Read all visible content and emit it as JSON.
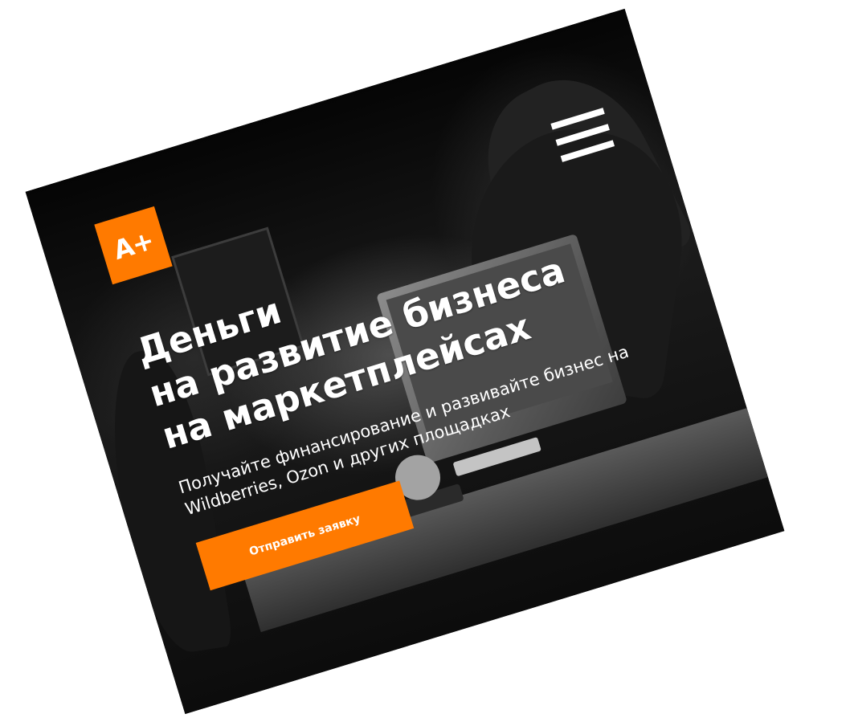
{
  "brand": {
    "logo_text": "A+",
    "accent_color": "#ff7a00"
  },
  "header": {
    "menu_icon": "hamburger-menu-icon"
  },
  "hero": {
    "headline_lines": [
      "Деньги",
      "на развитие бизнеса",
      "на маркетплейсах"
    ],
    "subtitle_lines": [
      "Получайте финансирование и развивайте бизнес на",
      "Wildberries, Ozon и других площадках"
    ],
    "cta_label": "Отправить заявку"
  }
}
